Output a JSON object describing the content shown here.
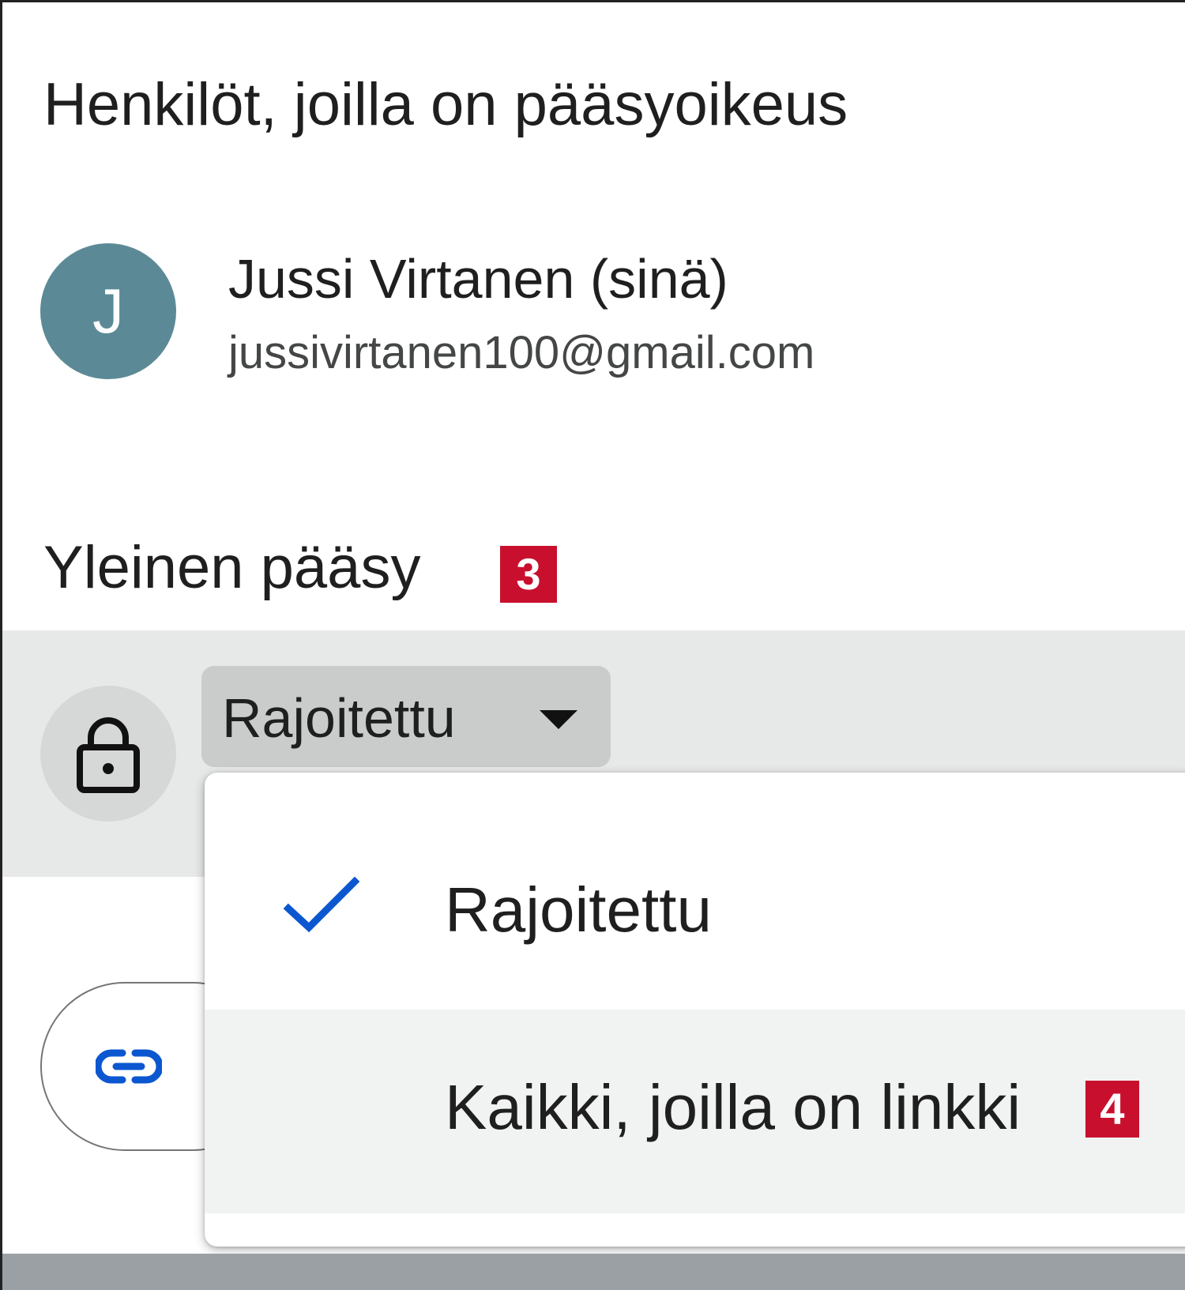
{
  "people_section": {
    "title": "Henkilöt, joilla on pääsyoikeus",
    "person": {
      "avatar_letter": "J",
      "avatar_color": "#5b8a96",
      "name": "Jussi Virtanen (sinä)",
      "email": "jussivirtanen100@gmail.com"
    }
  },
  "general_access": {
    "title": "Yleinen pääsy",
    "badge": "3",
    "icon": "lock-icon",
    "selected": "Rajoitettu",
    "dropdown": {
      "options": [
        {
          "label": "Rajoitettu",
          "checked": true,
          "icon": "check-icon"
        },
        {
          "label": "Kaikki, joilla on linkki",
          "checked": false,
          "badge": "4"
        }
      ]
    }
  },
  "copy_link": {
    "icon": "link-icon",
    "accent": "#0b57d0"
  },
  "colors": {
    "badge": "#c8102e",
    "check": "#0b57d0",
    "row_highlight": "#e7e9e8"
  }
}
